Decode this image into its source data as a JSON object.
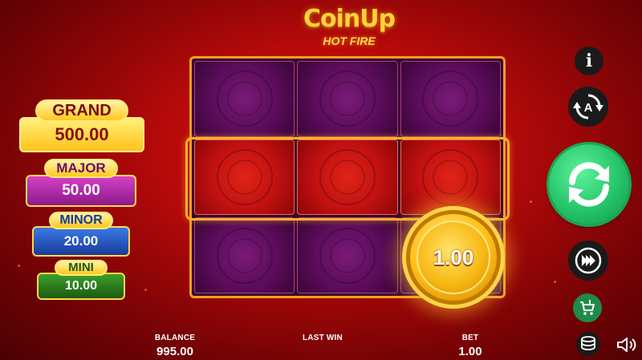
{
  "logo": {
    "title": "CoinUp",
    "subtitle": "HOT FIRE"
  },
  "jackpots": [
    {
      "label": "GRAND",
      "value": "500.00",
      "color": "#ffc21a"
    },
    {
      "label": "MAJOR",
      "value": "50.00",
      "color": "#b02aa8"
    },
    {
      "label": "MINOR",
      "value": "20.00",
      "color": "#2a5ac8"
    },
    {
      "label": "MINI",
      "value": "10.00",
      "color": "#2e8a1e"
    }
  ],
  "reels": {
    "rows": [
      [
        "empty",
        "empty",
        "empty"
      ],
      [
        "empty-active",
        "empty-active",
        "empty-active"
      ],
      [
        "empty",
        "empty",
        "coin"
      ]
    ],
    "coin_value": "1.00"
  },
  "controls": {
    "info_icon": "info-icon",
    "info_label": "i",
    "autoplay_icon": "autoplay-icon",
    "autoplay_label": "A",
    "spin_icon": "spin-icon",
    "turbo_icon": "turbo-icon",
    "shop_icon": "shop-icon",
    "stake_icon": "coin-stack-icon",
    "sound_icon": "speaker-icon"
  },
  "stats": {
    "balance_label": "BALANCE",
    "balance_value": "995.00",
    "last_win_label": "LAST WIN",
    "last_win_value": "",
    "bet_label": "BET",
    "bet_value": "1.00"
  },
  "colors": {
    "background": "#b80a0a",
    "grid_frame": "#f0a020",
    "spin_button": "#23c46a",
    "coin": "#ffc21a"
  }
}
